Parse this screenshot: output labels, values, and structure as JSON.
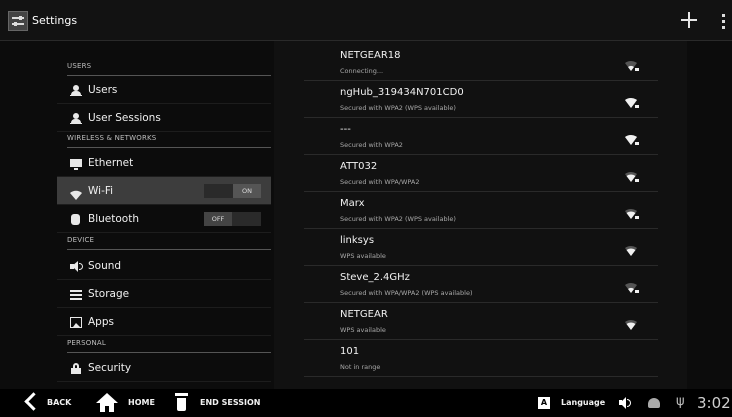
{
  "app": {
    "title": "Settings"
  },
  "actionbar": {
    "add_icon": "plus-icon",
    "overflow_icon": "overflow-menu-icon"
  },
  "sidebar": {
    "sections": [
      {
        "header": "USERS"
      },
      {
        "header": "WIRELESS & NETWORKS"
      },
      {
        "header": "DEVICE"
      },
      {
        "header": "PERSONAL"
      }
    ],
    "items": [
      {
        "label": "Users",
        "icon": "person-icon"
      },
      {
        "label": "User Sessions",
        "icon": "person-session-icon"
      },
      {
        "label": "Ethernet",
        "icon": "ethernet-icon"
      },
      {
        "label": "Wi-Fi",
        "icon": "wifi-icon",
        "toggle": "ON",
        "selected": true
      },
      {
        "label": "Bluetooth",
        "icon": "bluetooth-icon",
        "toggle": "OFF"
      },
      {
        "label": "Sound",
        "icon": "speaker-icon"
      },
      {
        "label": "Storage",
        "icon": "storage-icon"
      },
      {
        "label": "Apps",
        "icon": "apps-icon"
      },
      {
        "label": "Security",
        "icon": "lock-icon"
      }
    ]
  },
  "wifi_list": [
    {
      "name": "NETGEAR18",
      "status": "Connecting...",
      "signal": 2,
      "secured": true
    },
    {
      "name": "ngHub_319434N701CD0",
      "status": "Secured with WPA2 (WPS available)",
      "signal": 4,
      "secured": true
    },
    {
      "name": "---",
      "status": "Secured with WPA2",
      "signal": 4,
      "secured": true
    },
    {
      "name": "ATT032",
      "status": "Secured with WPA/WPA2",
      "signal": 3,
      "secured": true
    },
    {
      "name": "Marx",
      "status": "Secured with WPA2 (WPS available)",
      "signal": 3,
      "secured": true
    },
    {
      "name": "linksys",
      "status": "WPS available",
      "signal": 3,
      "secured": false
    },
    {
      "name": "Steve_2.4GHz",
      "status": "Secured with WPA/WPA2 (WPS available)",
      "signal": 2,
      "secured": true
    },
    {
      "name": "NETGEAR",
      "status": "WPS available",
      "signal": 3,
      "secured": false
    },
    {
      "name": "101",
      "status": "Not in range",
      "signal": 0,
      "secured": false
    }
  ],
  "bottombar": {
    "back_label": "BACK",
    "home_label": "HOME",
    "end_session_label": "END SESSION",
    "language_label": "Language",
    "language_icon_letter": "A",
    "time": "3:02"
  },
  "colors": {
    "background": "#0c0c0c",
    "selected": "#3d3d3d",
    "text": "#e6e6e6"
  }
}
